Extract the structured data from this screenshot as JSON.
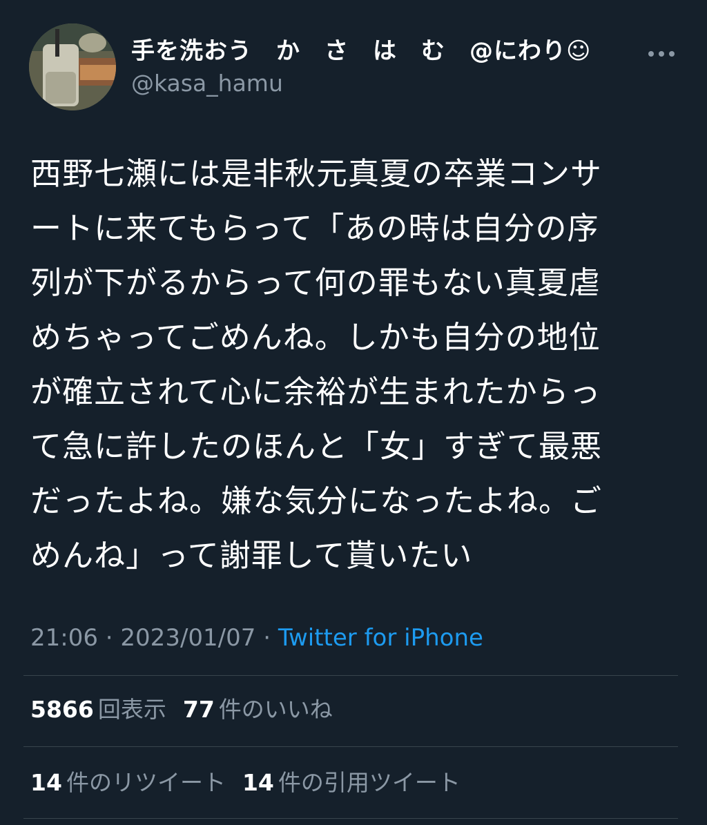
{
  "header": {
    "display_name": "手を洗おう　か　さ　は　む　@にわり☺",
    "username": "@kasa_hamu",
    "avatar_icon": "user-avatar-photo",
    "more_icon": "ellipsis-icon"
  },
  "tweet": {
    "lines": [
      "西野七瀬には是非秋元真夏の卒業コンサ",
      "ートに来てもらって「あの時は自分の序",
      "列が下がるからって何の罪もない真夏虐",
      "めちゃってごめんね。しかも自分の地位",
      "が確立されて心に余裕が生まれたからっ",
      "て急に許したのほんと「女」すぎて最悪",
      "だったよね。嫌な気分になったよね。ご",
      "めんね」って謝罪して貰いたい"
    ]
  },
  "meta": {
    "time": "21:06",
    "separator": " · ",
    "date": "2023/01/07",
    "source": "Twitter for iPhone"
  },
  "stats": {
    "views_count": "5866",
    "views_label": "回表示",
    "likes_count": "77",
    "likes_label": "件のいいね",
    "retweets_count": "14",
    "retweets_label": "件のリツイート",
    "quotes_count": "14",
    "quotes_label": "件の引用ツイート"
  },
  "colors": {
    "background": "#15202b",
    "text": "#ffffff",
    "secondary": "#8b98a5",
    "link": "#1d9bf0",
    "divider": "#38444d"
  }
}
